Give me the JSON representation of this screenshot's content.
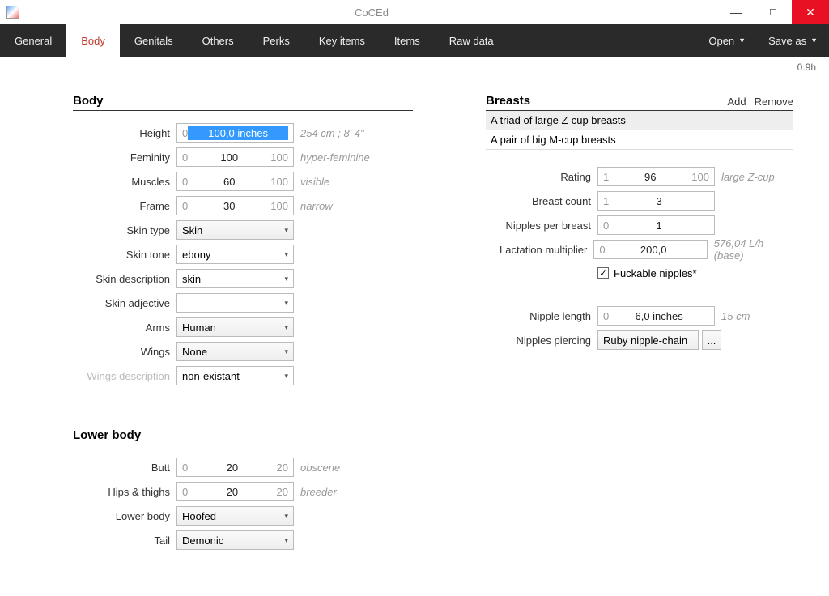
{
  "window": {
    "title": "CoCEd",
    "version": "0.9h"
  },
  "titlebar_buttons": {
    "min": "—",
    "max": "☐",
    "close": "✕"
  },
  "tabs": [
    "General",
    "Body",
    "Genitals",
    "Others",
    "Perks",
    "Key items",
    "Items",
    "Raw data"
  ],
  "active_tab": "Body",
  "menus": {
    "open": "Open",
    "save_as": "Save as"
  },
  "body": {
    "title": "Body",
    "rows": {
      "height": {
        "label": "Height",
        "min": "0",
        "val": "100,0 inches",
        "max": "",
        "hint": "254 cm ; 8' 4\""
      },
      "feminity": {
        "label": "Feminity",
        "min": "0",
        "val": "100",
        "max": "100",
        "hint": "hyper-feminine"
      },
      "muscles": {
        "label": "Muscles",
        "min": "0",
        "val": "60",
        "max": "100",
        "hint": "visible"
      },
      "frame": {
        "label": "Frame",
        "min": "0",
        "val": "30",
        "max": "100",
        "hint": "narrow"
      },
      "skin_type": {
        "label": "Skin type",
        "val": "Skin"
      },
      "skin_tone": {
        "label": "Skin tone",
        "val": "ebony"
      },
      "skin_desc": {
        "label": "Skin description",
        "val": "skin"
      },
      "skin_adj": {
        "label": "Skin adjective",
        "val": ""
      },
      "arms": {
        "label": "Arms",
        "val": "Human"
      },
      "wings": {
        "label": "Wings",
        "val": "None"
      },
      "wings_desc": {
        "label": "Wings description",
        "val": "non-existant"
      }
    }
  },
  "lower_body": {
    "title": "Lower body",
    "rows": {
      "butt": {
        "label": "Butt",
        "min": "0",
        "val": "20",
        "max": "20",
        "hint": "obscene"
      },
      "hips": {
        "label": "Hips & thighs",
        "min": "0",
        "val": "20",
        "max": "20",
        "hint": "breeder"
      },
      "lower": {
        "label": "Lower body",
        "val": "Hoofed"
      },
      "tail": {
        "label": "Tail",
        "val": "Demonic"
      }
    }
  },
  "breasts": {
    "title": "Breasts",
    "actions": {
      "add": "Add",
      "remove": "Remove"
    },
    "list": [
      "A triad of large Z-cup breasts",
      "A pair of big M-cup breasts"
    ],
    "rows": {
      "rating": {
        "label": "Rating",
        "min": "1",
        "val": "96",
        "max": "100",
        "hint": "large Z-cup"
      },
      "count": {
        "label": "Breast count",
        "min": "1",
        "val": "3",
        "max": ""
      },
      "nipples": {
        "label": "Nipples per breast",
        "min": "0",
        "val": "1",
        "max": ""
      },
      "lactation": {
        "label": "Lactation multiplier",
        "min": "0",
        "val": "200,0",
        "max": "",
        "hint": "576,04 L/h (base)"
      },
      "fuckable": {
        "label": "Fuckable nipples*",
        "checked": "✓"
      },
      "nipple_length": {
        "label": "Nipple length",
        "min": "0",
        "val": "6,0 inches",
        "max": "",
        "hint": "15 cm"
      },
      "piercing": {
        "label": "Nipples piercing",
        "val": "Ruby nipple-chain",
        "dots": "..."
      }
    }
  }
}
